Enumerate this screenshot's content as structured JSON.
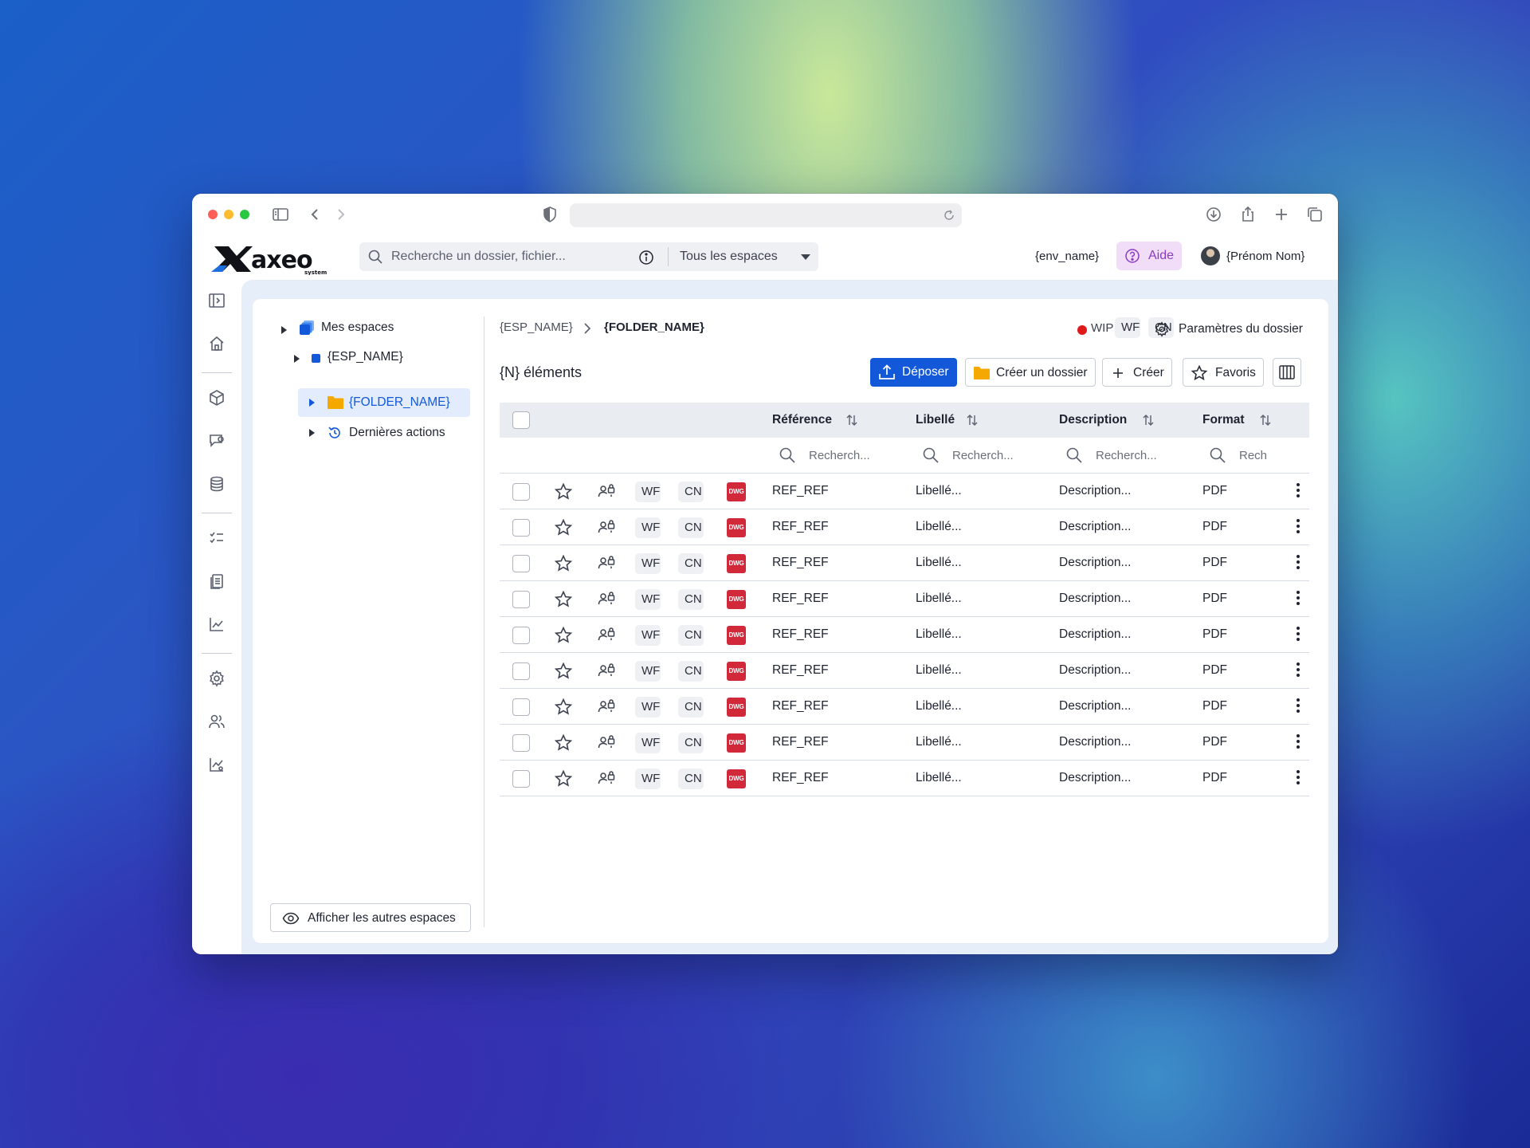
{
  "app": {
    "search_placeholder": "Recherche un dossier, fichier...",
    "scope": "Tous les espaces",
    "env": "{env_name}",
    "help": "Aide",
    "user": "{Prénom Nom}"
  },
  "tree": {
    "root": "Mes espaces",
    "space": "{ESP_NAME}",
    "folder": "{FOLDER_NAME}",
    "recent": "Dernières actions",
    "other_spaces": "Afficher les autres espaces"
  },
  "breadcrumb": {
    "space": "{ESP_NAME}",
    "folder": "{FOLDER_NAME}"
  },
  "status": {
    "wip": "WIP",
    "wf": "WF",
    "cn": "CN",
    "params": "Paramètres du dossier"
  },
  "toolbar": {
    "count": "{N} éléments",
    "upload": "Déposer",
    "create_folder": "Créer un dossier",
    "create": "Créer",
    "favorites": "Favoris"
  },
  "table": {
    "columns": [
      "Référence",
      "Libellé",
      "Description",
      "Format"
    ],
    "filter_placeholders": [
      "Recherch...",
      "Recherch...",
      "Recherch...",
      "Rech"
    ],
    "rows": [
      {
        "wf": "WF",
        "cn": "CN",
        "type": "DWG",
        "ref": "REF_REF",
        "label": "Libellé...",
        "desc": "Description...",
        "format": "PDF"
      },
      {
        "wf": "WF",
        "cn": "CN",
        "type": "DWG",
        "ref": "REF_REF",
        "label": "Libellé...",
        "desc": "Description...",
        "format": "PDF"
      },
      {
        "wf": "WF",
        "cn": "CN",
        "type": "DWG",
        "ref": "REF_REF",
        "label": "Libellé...",
        "desc": "Description...",
        "format": "PDF"
      },
      {
        "wf": "WF",
        "cn": "CN",
        "type": "DWG",
        "ref": "REF_REF",
        "label": "Libellé...",
        "desc": "Description...",
        "format": "PDF"
      },
      {
        "wf": "WF",
        "cn": "CN",
        "type": "DWG",
        "ref": "REF_REF",
        "label": "Libellé...",
        "desc": "Description...",
        "format": "PDF"
      },
      {
        "wf": "WF",
        "cn": "CN",
        "type": "DWG",
        "ref": "REF_REF",
        "label": "Libellé...",
        "desc": "Description...",
        "format": "PDF"
      },
      {
        "wf": "WF",
        "cn": "CN",
        "type": "DWG",
        "ref": "REF_REF",
        "label": "Libellé...",
        "desc": "Description...",
        "format": "PDF"
      },
      {
        "wf": "WF",
        "cn": "CN",
        "type": "DWG",
        "ref": "REF_REF",
        "label": "Libellé...",
        "desc": "Description...",
        "format": "PDF"
      },
      {
        "wf": "WF",
        "cn": "CN",
        "type": "DWG",
        "ref": "REF_REF",
        "label": "Libellé...",
        "desc": "Description...",
        "format": "PDF"
      }
    ]
  },
  "colors": {
    "primary": "#1358d8",
    "folder": "#f5a800",
    "wip": "#e01a1a",
    "dwg": "#d1283a",
    "help_bg": "#f1ddf8"
  },
  "icons": [
    "sidebar-toggle-icon",
    "chevron-left-icon",
    "chevron-right-icon",
    "shield-icon",
    "reload-icon",
    "download-icon",
    "share-icon",
    "plus-icon",
    "tabs-icon",
    "search-icon",
    "info-icon",
    "help-icon",
    "rail-collapse-icon",
    "home-icon",
    "cube-icon",
    "message-icon",
    "database-icon",
    "checklist-icon",
    "documents-icon",
    "chart-icon",
    "gear-icon",
    "users-icon",
    "analytics-icon",
    "eye-icon",
    "upload-icon",
    "folder-icon",
    "star-icon",
    "user-lock-icon",
    "columns-icon",
    "more-icon",
    "history-icon",
    "sort-icon"
  ]
}
